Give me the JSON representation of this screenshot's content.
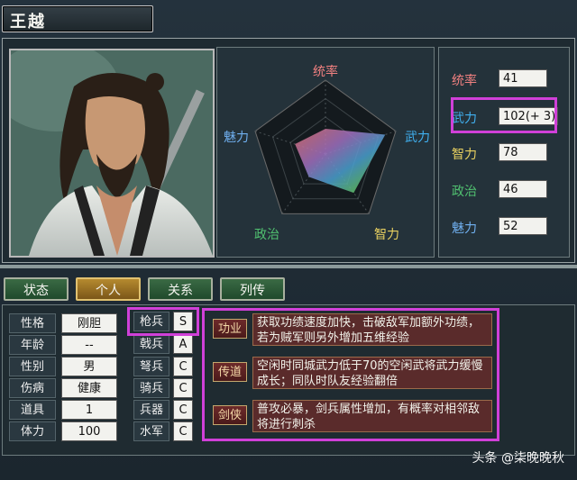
{
  "general": {
    "name": "王越"
  },
  "radar": {
    "labels": {
      "top": "统率",
      "right": "武力",
      "bottom_right": "智力",
      "bottom_left": "政治",
      "left": "魅力"
    },
    "axis_order": [
      "统率",
      "武力",
      "智力",
      "政治",
      "魅力"
    ],
    "values": [
      41,
      102,
      78,
      46,
      52
    ],
    "max": 120,
    "colors": {
      "統率": "#e06060",
      "武力": "#2f9fd8",
      "智力": "#e0c040",
      "政治": "#4aa860",
      "魅力": "#5aa8e0"
    }
  },
  "stats": [
    {
      "label": "统率",
      "value": "41",
      "color": "#f08080"
    },
    {
      "label": "武力",
      "value": "102(+ 3)",
      "color": "#40b0f0"
    },
    {
      "label": "智力",
      "value": "78",
      "color": "#e8d060"
    },
    {
      "label": "政治",
      "value": "46",
      "color": "#50c070"
    },
    {
      "label": "魅力",
      "value": "52",
      "color": "#70b0f0"
    }
  ],
  "tabs": [
    "状态",
    "个人",
    "关系",
    "列传"
  ],
  "active_tab": "个人",
  "info": [
    {
      "label": "性格",
      "value": "刚胆"
    },
    {
      "label": "年龄",
      "value": "--"
    },
    {
      "label": "性别",
      "value": "男"
    },
    {
      "label": "伤病",
      "value": "健康"
    },
    {
      "label": "道具",
      "value": "1"
    },
    {
      "label": "体力",
      "value": "100"
    }
  ],
  "troops": [
    {
      "label": "枪兵",
      "grade": "S"
    },
    {
      "label": "戟兵",
      "grade": "A"
    },
    {
      "label": "弩兵",
      "grade": "C"
    },
    {
      "label": "骑兵",
      "grade": "C"
    },
    {
      "label": "兵器",
      "grade": "C"
    },
    {
      "label": "水军",
      "grade": "C"
    }
  ],
  "skills": [
    {
      "name": "功业",
      "desc": "获取功绩速度加快，击破敌军加额外功绩，若为贼军则另外增加五维经验"
    },
    {
      "name": "传道",
      "desc": "空闲时同城武力低于70的空闲武将武力缓慢成长；同队时队友经验翻倍"
    },
    {
      "name": "剑侠",
      "desc": "普攻必暴，剑兵属性增加，有概率对相邻敌将进行刺杀"
    }
  ],
  "watermark": "头条 @柒晚晚秋"
}
